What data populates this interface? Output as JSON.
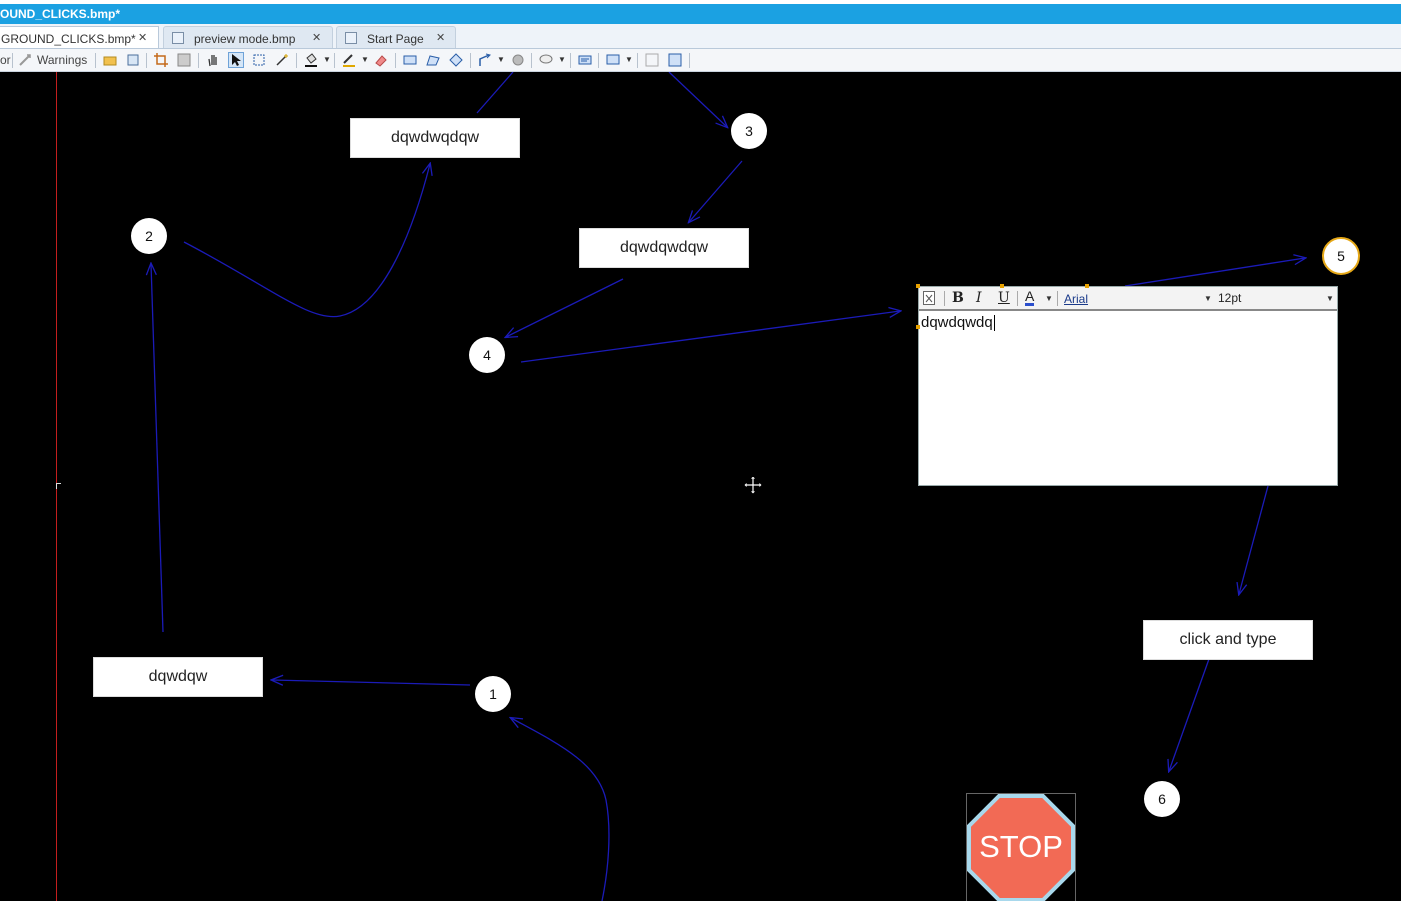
{
  "window": {
    "title": "OUND_CLICKS.bmp*"
  },
  "tabs": [
    {
      "label": "GROUND_CLICKS.bmp*",
      "close": "✕",
      "active": true
    },
    {
      "label": "preview mode.bmp",
      "close": "✕",
      "active": false
    },
    {
      "label": "Start Page",
      "close": "✕",
      "active": false
    }
  ],
  "toolbar": {
    "left_fragment": "or",
    "warnings_label": "Warnings"
  },
  "canvas": {
    "boxes": [
      {
        "text": "dqwdwqdqw"
      },
      {
        "text": "dqwdqwdqw"
      },
      {
        "text": "dqwdqw"
      },
      {
        "text": "click and type"
      }
    ],
    "steps": [
      {
        "label": "1"
      },
      {
        "label": "2"
      },
      {
        "label": "3"
      },
      {
        "label": "4"
      },
      {
        "label": "5"
      },
      {
        "label": "6"
      }
    ],
    "stop_sign": {
      "text": "STOP"
    }
  },
  "text_editor": {
    "bold": "B",
    "italic": "I",
    "underline": "U",
    "font_color": "A",
    "font_name": "Arial",
    "font_size": "12pt",
    "content": "dqwdqwdq"
  },
  "colors": {
    "title_bar": "#1ba1e2",
    "canvas_bg": "#000000",
    "arrow": "#1b1bb8",
    "margin_line": "#c41e1e",
    "stop_sign": "#f26a55",
    "stop_border": "#a8d8ec",
    "step5_border": "#e6a817"
  }
}
